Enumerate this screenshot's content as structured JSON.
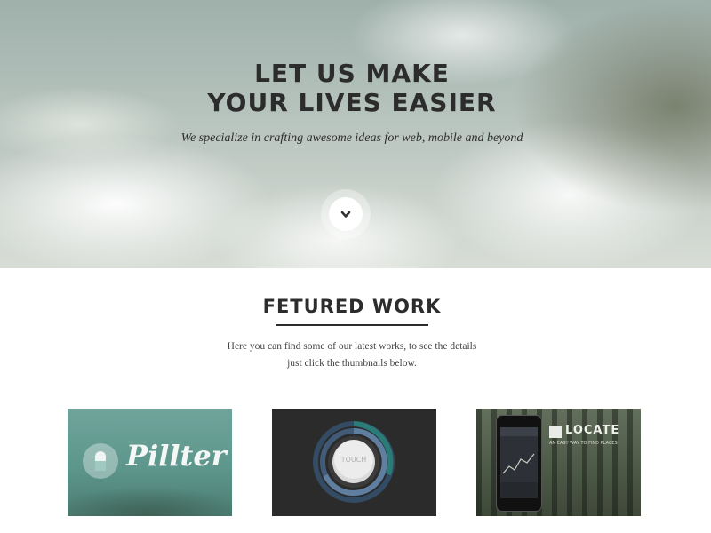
{
  "hero": {
    "title_line1": "LET US MAKE",
    "title_line2": "YOUR LIVES EASIER",
    "subtitle": "We specialize in crafting awesome ideas for web, mobile and beyond",
    "scroll_icon": "chevron-down-icon"
  },
  "featured": {
    "title": "FETURED WORK",
    "desc_line1": "Here you can find some of our latest works, to see the details",
    "desc_line2": "just click the thumbnails below."
  },
  "works": [
    {
      "word": "Pillter",
      "icon": "pill-icon"
    },
    {
      "label": "TOUCH",
      "icon": "touch-dial-icon"
    },
    {
      "word": "LOCATE",
      "tagline": "AN EASY WAY TO FIND PLACES",
      "icon": "locate-logo-icon"
    }
  ],
  "colors": {
    "text_dark": "#2c2c2c",
    "pillter_teal": "#5d968c",
    "touch_bg": "#2b2b2b",
    "dial_ring_teal": "#2a7c78",
    "dial_ring_blue": "#405a78"
  }
}
